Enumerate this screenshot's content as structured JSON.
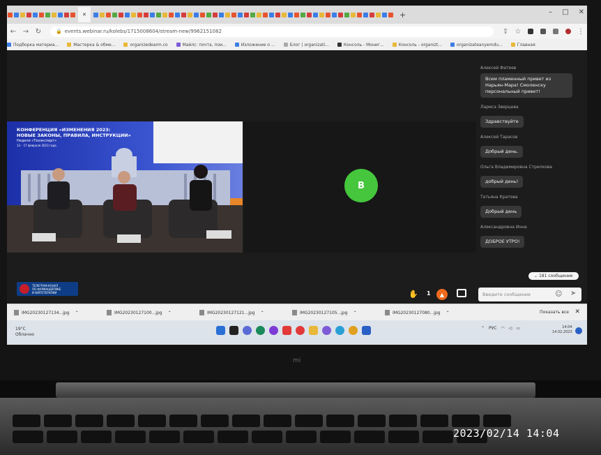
{
  "browser": {
    "url": "events.webinar.ru/kolebs/1715008604/stream-new/9962151082",
    "bookmarks": [
      "Подборка материа...",
      "Мастерка & обме...",
      "organizedearm.co",
      "Майлс: почта, пои...",
      "Изложение о ...",
      "Блог | organizati...",
      "Консоль - Мониг...",
      "Консоль - organizt...",
      "organizateanyemdu...",
      "Главная"
    ]
  },
  "conference": {
    "title_line1": "КОНФЕРЕНЦИЯ «ИЗМЕНЕНИЯ 2023:",
    "title_line2": "НОВЫЕ ЗАКОНЫ, ПРАВИЛА, ИНСТРУКЦИИ»",
    "subtitle": "Неделя «Техэксперт»",
    "dates": "13 – 17 февраля 2023 года"
  },
  "channel_logo": {
    "line1": "ТЕЛЕГРАМ-КАНАЛ",
    "line2": "ПО ФАРМАЦЕВТИКЕ",
    "line3": "И ФИТОТЕРАПИИ"
  },
  "participant": {
    "initial": "В"
  },
  "chat": {
    "messages": [
      {
        "author": "Алексей Фатеев",
        "text": "Всем пламенный привет из Нарьян-Мара! Смоленску персональный привет!"
      },
      {
        "author": "Лариса Зверцева",
        "text": "Здравствуйте"
      },
      {
        "author": "Алексей Тарасов",
        "text": "Добрый день."
      },
      {
        "author": "Ольга Владимировна Стрелкова",
        "text": "добрый день!"
      },
      {
        "author": "Татьяна Кратова",
        "text": "Добрый день"
      },
      {
        "author": "Александровна Инна",
        "text": "ДОБРОЕ УТРО!"
      }
    ],
    "message_count": "181 сообщение",
    "input_placeholder": "Введите сообщение"
  },
  "controls": {
    "raised_hands": "1"
  },
  "downloads": {
    "items": [
      "IMG20230127134...jpg",
      "IMG20230127100...jpg",
      "IMG20230127121...jpg",
      "IMG20230127105...jpg",
      "IMG20230127080...jpg"
    ],
    "show_all": "Показать все"
  },
  "taskbar": {
    "weather_temp": "19°C",
    "weather_desc": "Облачно",
    "lang": "РУС",
    "time": "14:04",
    "date": "14.02.2023"
  },
  "camera_timestamp": "2023/02/14  14:04",
  "brand_colors": {
    "green_avatar": "#45c63c",
    "orange_control": "#f06a1d",
    "channel_blue": "#0e3d86"
  }
}
